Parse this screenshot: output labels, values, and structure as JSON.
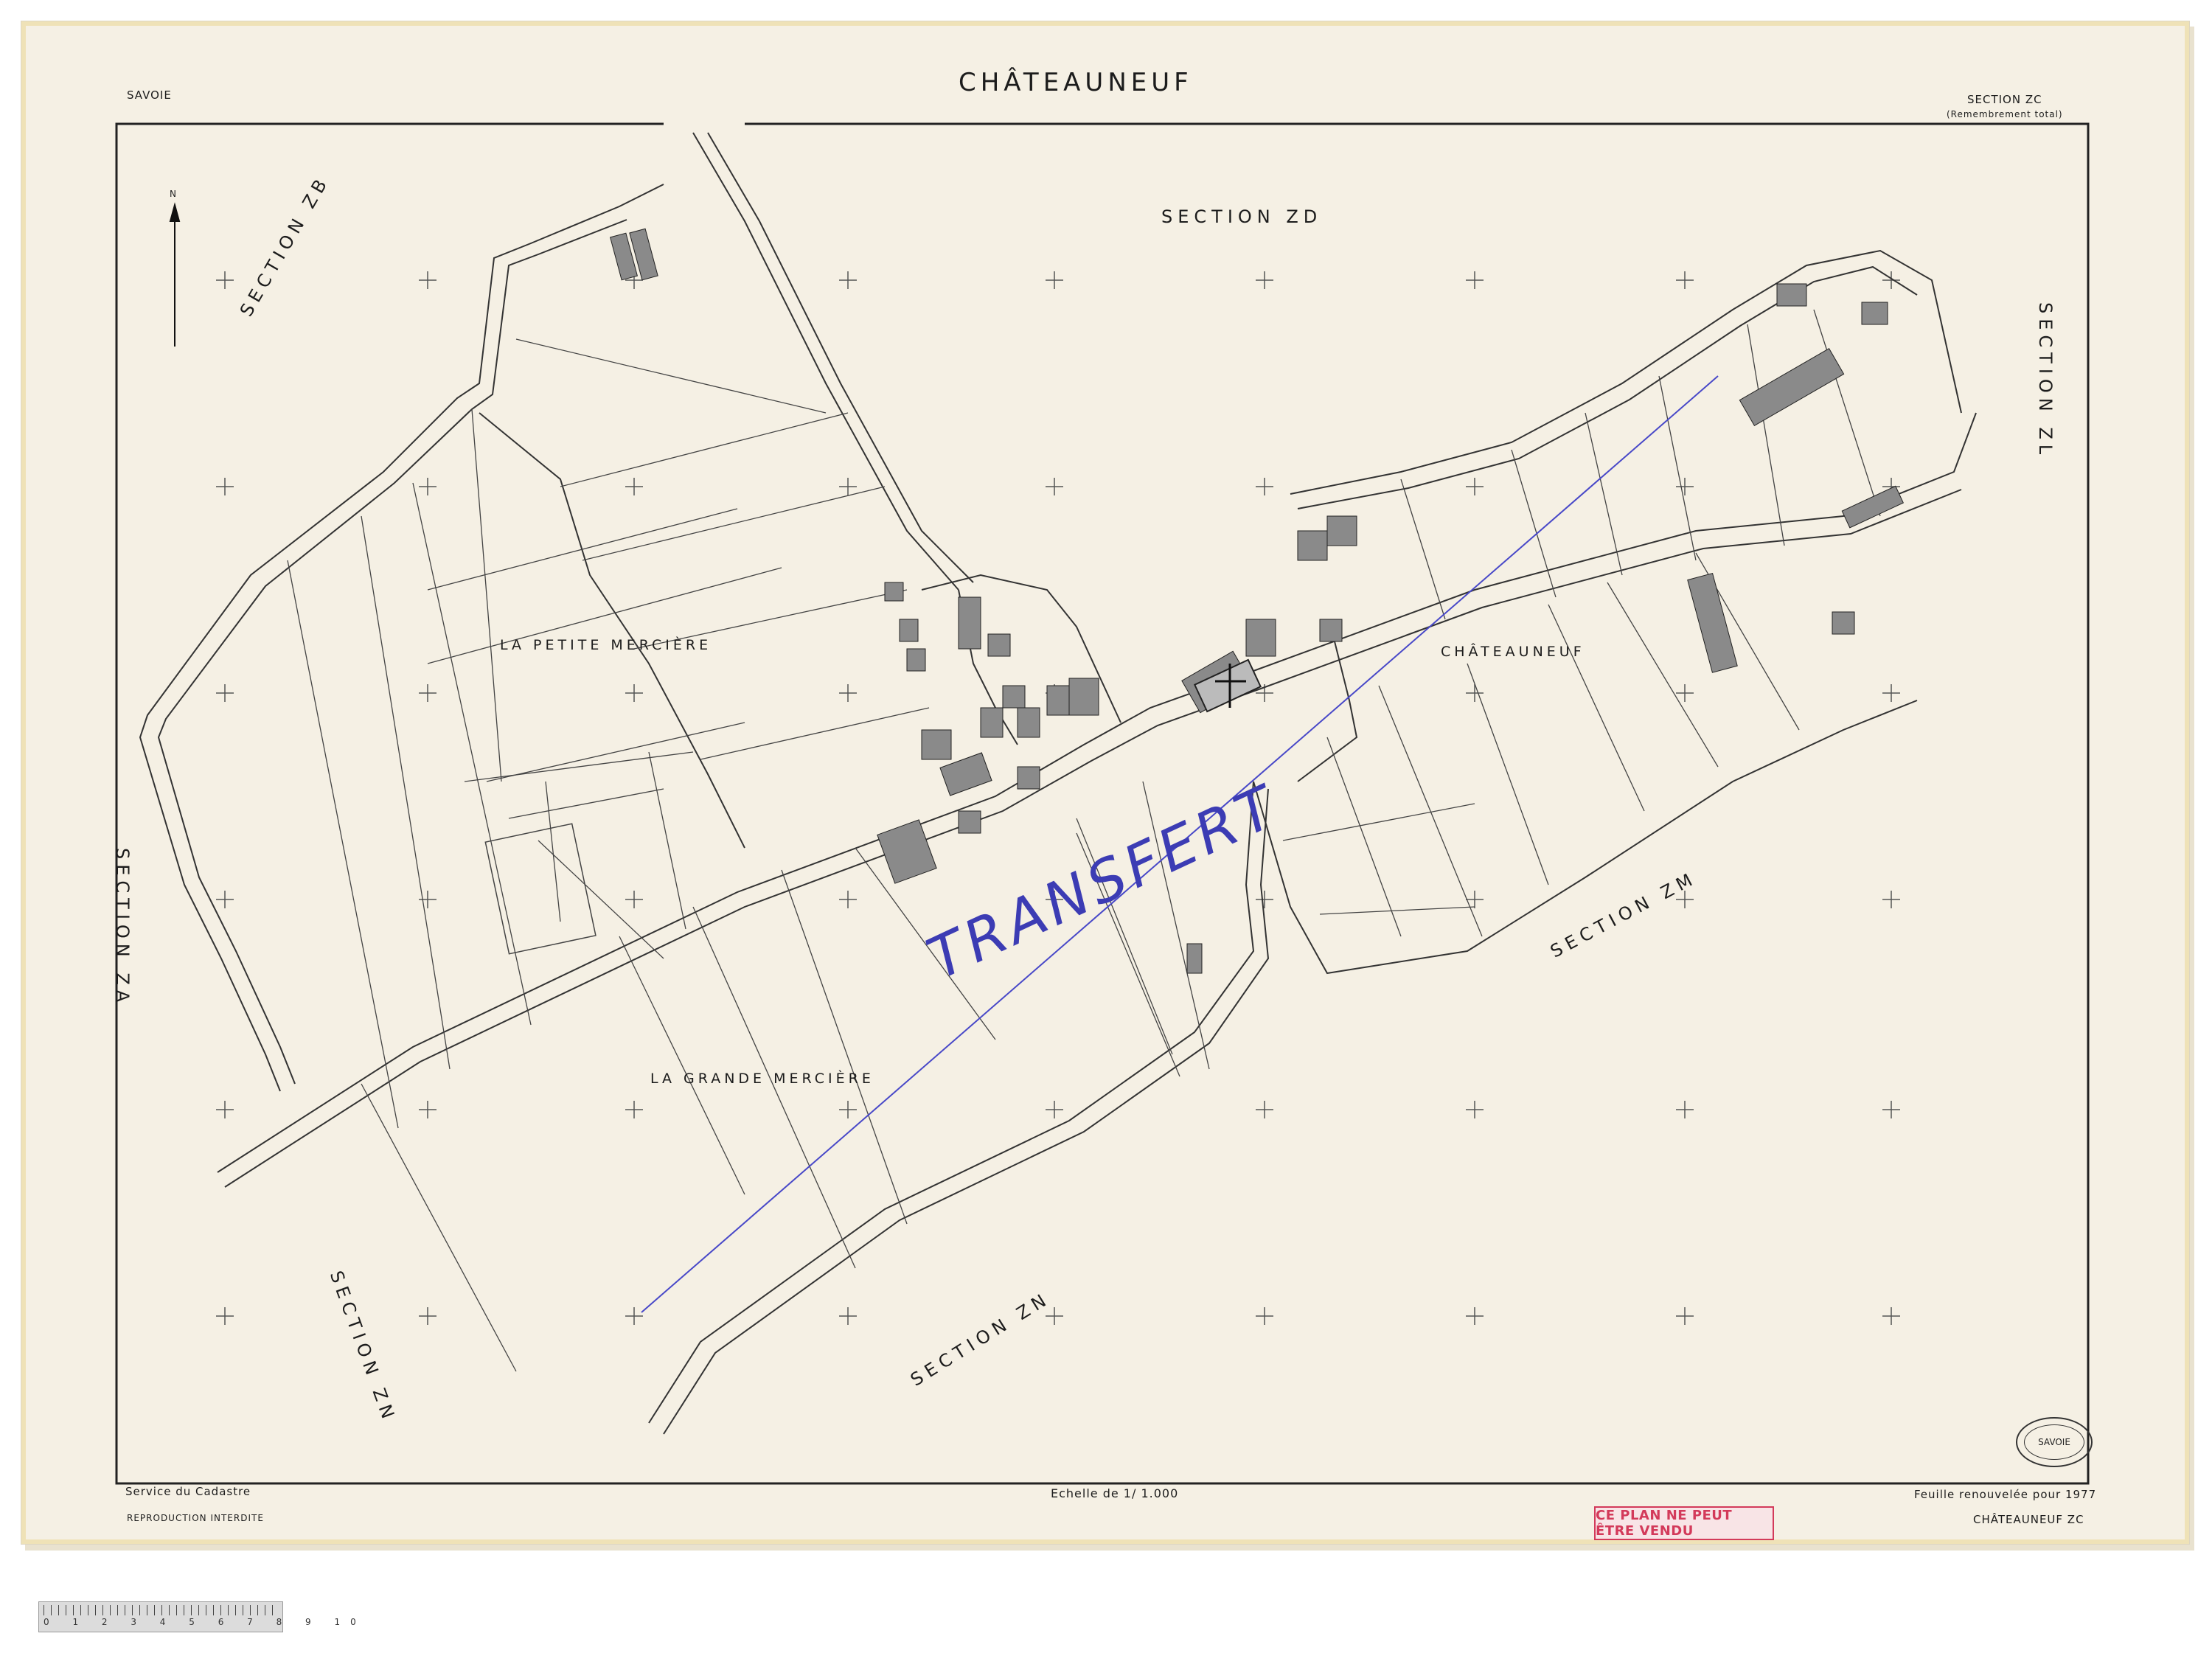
{
  "header": {
    "title": "CHÂTEAUNEUF",
    "department": "SAVOIE",
    "section": "SECTION ZC",
    "section_note": "(Remembrement total)"
  },
  "footer": {
    "service": "Service du Cadastre",
    "reproduction": "REPRODUCTION INTERDITE",
    "scale": "Echelle de 1/ 1.000",
    "renewal": "Feuille renouvelée pour 1977",
    "sheet_code": "CHÂTEAUNEUF ZC",
    "warning": "CE PLAN NE PEUT ÊTRE VENDU",
    "stamp": "SAVOIE"
  },
  "sections": {
    "zd": "SECTION     ZD",
    "zb": "SECTION     ZB",
    "za": "SECTION     ZA",
    "zl": "SECTION     ZL",
    "zm": "SECTION     ZM",
    "zn_left": "SECTION     ZN",
    "zn_bottom": "SECTION     ZN"
  },
  "places": {
    "petite": "LA PETITE MERCIÈRE",
    "grande": "LA GRANDE MERCIÈRE",
    "chateauneuf": "CHÂTEAUNEUF"
  },
  "annotation": {
    "transfert": "TRANSFERT",
    "color": "#3c3cb4"
  },
  "north": "N",
  "ruler_numbers": "0 1 2 3 4 5 6 7 8 9 10",
  "colors": {
    "paper": "#f5f0e4",
    "ink": "#1c1c1c",
    "warning": "#d33a5a"
  }
}
